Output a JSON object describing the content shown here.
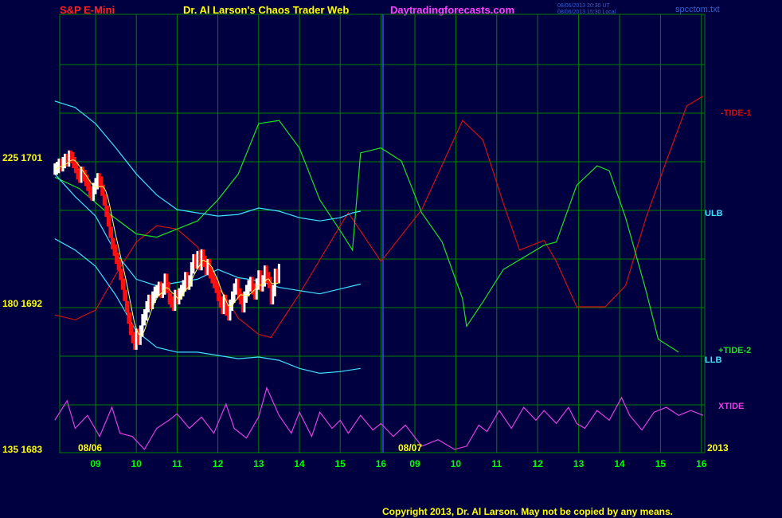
{
  "header": {
    "symbol": "S&P E-Mini",
    "title": "Dr. Al Larson's Chaos Trader Web",
    "site": "Daytradingforecasts.com",
    "timestamp_line1": "08/06/2013 20:30 UT",
    "timestamp_line2": "08/06/2013 15:30 Local",
    "filename": "spcctom.txt"
  },
  "y_labels": {
    "top": "225  1701",
    "middle": "180  1692",
    "bottom": "135  1683"
  },
  "right_labels": {
    "tide1": "-TIDE-1",
    "ulb": "ULB",
    "tide2": "+TIDE-2",
    "llb": "LLB",
    "xtide": "XTIDE"
  },
  "date_labels": {
    "day1": "08/06",
    "day2": "08/07",
    "year": "2013"
  },
  "copyright": "Copyright 2013, Dr. Al Larson. May not be copied by any means.",
  "colors": {
    "background": "#000040",
    "grid": "#008000",
    "divider": "#4040ff",
    "tide1": "#d01010",
    "tide2": "#20e020",
    "ulb": "#40e0ff",
    "llb": "#40e0ff",
    "xtide": "#e040e0",
    "price_up": "#ffffff",
    "price_down": "#ff1010",
    "ma": "#ffff60"
  },
  "chart_data": {
    "type": "line",
    "x_tick_labels": [
      "09",
      "10",
      "11",
      "12",
      "13",
      "14",
      "15",
      "16",
      "09",
      "10",
      "11",
      "12",
      "13",
      "14",
      "15",
      "16"
    ],
    "y_axis": {
      "label_top": "1701",
      "label_mid": "1692",
      "label_bottom": "1683",
      "range": [
        1683,
        1705
      ]
    },
    "series": [
      {
        "name": "-TIDE-1",
        "color": "#d01010",
        "points": [
          [
            0.0,
            1691.5
          ],
          [
            0.5,
            1691.2
          ],
          [
            1.0,
            1691.8
          ],
          [
            1.5,
            1694.0
          ],
          [
            2.0,
            1696.0
          ],
          [
            2.5,
            1697.0
          ],
          [
            3.0,
            1696.8
          ],
          [
            3.5,
            1695.7
          ],
          [
            4.0,
            1693.4
          ],
          [
            4.5,
            1691.3
          ],
          [
            5.0,
            1690.3
          ],
          [
            5.3,
            1690.1
          ],
          [
            6.0,
            1692.8
          ],
          [
            7.0,
            1697.0
          ],
          [
            7.2,
            1697.8
          ],
          [
            8.0,
            1694.8
          ],
          [
            9.0,
            1698.0
          ],
          [
            10.0,
            1703.5
          ],
          [
            10.5,
            1702.3
          ],
          [
            11.0,
            1698.4
          ],
          [
            11.4,
            1695.5
          ],
          [
            12.0,
            1696.1
          ],
          [
            12.3,
            1694.8
          ],
          [
            12.8,
            1692.0
          ],
          [
            13.5,
            1692.0
          ],
          [
            14.0,
            1693.3
          ],
          [
            14.5,
            1697.5
          ],
          [
            15.0,
            1701.0
          ],
          [
            15.5,
            1704.4
          ],
          [
            15.9,
            1705.0
          ]
        ]
      },
      {
        "name": "+TIDE-2",
        "color": "#20e020",
        "points": [
          [
            0.0,
            1700.0
          ],
          [
            0.6,
            1699.3
          ],
          [
            1.2,
            1698.0
          ],
          [
            2.0,
            1696.5
          ],
          [
            2.5,
            1696.3
          ],
          [
            3.0,
            1696.8
          ],
          [
            3.5,
            1697.3
          ],
          [
            4.0,
            1698.6
          ],
          [
            4.5,
            1700.2
          ],
          [
            5.0,
            1703.3
          ],
          [
            5.5,
            1703.5
          ],
          [
            6.0,
            1701.8
          ],
          [
            6.5,
            1698.6
          ],
          [
            7.0,
            1696.7
          ],
          [
            7.3,
            1695.5
          ],
          [
            7.5,
            1701.5
          ],
          [
            8.0,
            1701.8
          ],
          [
            8.5,
            1701.0
          ],
          [
            9.0,
            1697.8
          ],
          [
            9.5,
            1696.0
          ],
          [
            10.0,
            1692.5
          ],
          [
            10.1,
            1690.8
          ],
          [
            10.5,
            1692.3
          ],
          [
            11.0,
            1694.3
          ],
          [
            12.0,
            1695.8
          ],
          [
            12.3,
            1696.0
          ],
          [
            12.8,
            1699.5
          ],
          [
            13.3,
            1700.7
          ],
          [
            13.6,
            1700.4
          ],
          [
            14.0,
            1697.5
          ],
          [
            14.5,
            1693.0
          ],
          [
            14.8,
            1690.0
          ],
          [
            15.3,
            1689.2
          ]
        ]
      },
      {
        "name": "ULB",
        "color": "#40e0ff",
        "points": [
          [
            0.0,
            1704.7
          ],
          [
            0.5,
            1704.3
          ],
          [
            1.0,
            1703.3
          ],
          [
            1.5,
            1701.8
          ],
          [
            2.0,
            1700.2
          ],
          [
            2.5,
            1698.9
          ],
          [
            3.0,
            1698.0
          ],
          [
            3.5,
            1697.8
          ],
          [
            4.0,
            1697.6
          ],
          [
            4.5,
            1697.7
          ],
          [
            5.0,
            1698.1
          ],
          [
            5.5,
            1697.9
          ],
          [
            6.0,
            1697.5
          ],
          [
            6.5,
            1697.3
          ],
          [
            7.0,
            1697.5
          ],
          [
            7.3,
            1697.8
          ],
          [
            7.5,
            1697.9
          ]
        ]
      },
      {
        "name": "LLB",
        "color": "#40e0ff",
        "points": [
          [
            0.0,
            1696.2
          ],
          [
            0.5,
            1695.5
          ],
          [
            1.0,
            1694.5
          ],
          [
            1.5,
            1692.7
          ],
          [
            2.0,
            1690.5
          ],
          [
            2.5,
            1689.5
          ],
          [
            3.0,
            1689.2
          ],
          [
            3.5,
            1689.2
          ],
          [
            4.0,
            1689.0
          ],
          [
            4.5,
            1688.8
          ],
          [
            5.0,
            1688.9
          ],
          [
            5.5,
            1688.7
          ],
          [
            6.0,
            1688.2
          ],
          [
            6.5,
            1687.9
          ],
          [
            7.0,
            1688.0
          ],
          [
            7.5,
            1688.2
          ]
        ]
      },
      {
        "name": "ULB",
        "color": "#40e0ff",
        "points": [
          [
            0.0,
            1700.2
          ],
          [
            0.5,
            1698.8
          ],
          [
            1.0,
            1697.6
          ],
          [
            1.5,
            1695.3
          ],
          [
            2.0,
            1693.7
          ],
          [
            2.5,
            1693.3
          ],
          [
            3.0,
            1693.5
          ],
          [
            3.5,
            1693.7
          ],
          [
            4.0,
            1694.3
          ],
          [
            4.5,
            1693.8
          ],
          [
            5.0,
            1693.6
          ],
          [
            5.5,
            1693.2
          ],
          [
            6.0,
            1693.0
          ],
          [
            6.5,
            1692.8
          ],
          [
            7.0,
            1693.1
          ],
          [
            7.5,
            1693.4
          ]
        ]
      },
      {
        "name": "XTIDE",
        "color": "#e040e0",
        "points": [
          [
            0.0,
            1685.0
          ],
          [
            0.3,
            1686.2
          ],
          [
            0.5,
            1684.5
          ],
          [
            0.8,
            1685.3
          ],
          [
            1.1,
            1684.0
          ],
          [
            1.4,
            1685.8
          ],
          [
            1.6,
            1684.2
          ],
          [
            1.9,
            1684.0
          ],
          [
            2.2,
            1683.2
          ],
          [
            2.5,
            1684.5
          ],
          [
            2.8,
            1685.0
          ],
          [
            3.0,
            1685.4
          ],
          [
            3.3,
            1684.5
          ],
          [
            3.6,
            1685.2
          ],
          [
            3.9,
            1684.2
          ],
          [
            4.2,
            1686.0
          ],
          [
            4.4,
            1684.5
          ],
          [
            4.7,
            1683.9
          ],
          [
            5.0,
            1685.2
          ],
          [
            5.2,
            1687.0
          ],
          [
            5.5,
            1685.3
          ],
          [
            5.8,
            1684.2
          ],
          [
            6.0,
            1685.5
          ],
          [
            6.3,
            1684.0
          ],
          [
            6.5,
            1685.5
          ],
          [
            6.8,
            1684.5
          ],
          [
            7.0,
            1685.0
          ],
          [
            7.2,
            1684.2
          ],
          [
            7.5,
            1685.3
          ],
          [
            7.8,
            1684.4
          ],
          [
            8.0,
            1684.8
          ],
          [
            8.3,
            1684.0
          ],
          [
            8.6,
            1684.7
          ],
          [
            9.0,
            1683.4
          ],
          [
            9.4,
            1683.8
          ],
          [
            9.8,
            1683.2
          ],
          [
            10.1,
            1683.4
          ],
          [
            10.4,
            1684.7
          ],
          [
            10.6,
            1684.3
          ],
          [
            10.9,
            1685.6
          ],
          [
            11.2,
            1684.5
          ],
          [
            11.5,
            1685.8
          ],
          [
            11.8,
            1685.0
          ],
          [
            12.0,
            1685.6
          ],
          [
            12.3,
            1684.8
          ],
          [
            12.6,
            1685.8
          ],
          [
            12.8,
            1684.8
          ],
          [
            13.0,
            1684.5
          ],
          [
            13.3,
            1685.6
          ],
          [
            13.6,
            1685.0
          ],
          [
            13.9,
            1686.4
          ],
          [
            14.1,
            1685.3
          ],
          [
            14.4,
            1684.4
          ],
          [
            14.7,
            1685.5
          ],
          [
            15.0,
            1685.8
          ],
          [
            15.3,
            1685.3
          ],
          [
            15.6,
            1685.6
          ],
          [
            15.9,
            1685.3
          ]
        ]
      }
    ],
    "price": {
      "name": "S&P E-Mini",
      "x_start": 0.0,
      "x_step": 0.05,
      "close": [
        1700.5,
        1700.6,
        1700.8,
        1700.7,
        1700.9,
        1701.1,
        1701.0,
        1701.3,
        1701.2,
        1700.9,
        1700.6,
        1700.2,
        1700.0,
        1700.3,
        1700.1,
        1699.8,
        1699.5,
        1699.1,
        1698.9,
        1699.3,
        1699.6,
        1699.9,
        1699.7,
        1699.2,
        1698.6,
        1697.9,
        1697.3,
        1696.6,
        1695.9,
        1695.5,
        1695.0,
        1694.6,
        1694.0,
        1693.4,
        1692.7,
        1692.0,
        1691.3,
        1690.6,
        1690.1,
        1689.7,
        1690.3,
        1690.0,
        1690.5,
        1691.2,
        1691.5,
        1692.0,
        1692.4,
        1692.2,
        1692.6,
        1692.9,
        1693.0,
        1693.2,
        1692.9,
        1693.1,
        1693.7,
        1693.2,
        1692.5,
        1692.3,
        1692.1,
        1692.7,
        1692.5,
        1692.8,
        1693.0,
        1693.3,
        1693.8,
        1693.4,
        1693.6,
        1694.4,
        1694.9,
        1694.7,
        1695.1,
        1694.6,
        1695.2,
        1694.8,
        1694.3,
        1694.6,
        1694.1,
        1693.8,
        1693.5,
        1693.2,
        1692.7,
        1692.3,
        1691.9,
        1692.4,
        1691.8,
        1691.5,
        1692.1,
        1692.6,
        1693.1,
        1693.4,
        1692.8,
        1692.5,
        1692.0,
        1692.6,
        1693.0,
        1693.3,
        1693.5,
        1693.1,
        1692.8,
        1693.4,
        1693.9,
        1693.3,
        1693.6,
        1694.2,
        1693.8,
        1693.5,
        1692.5,
        1693.0,
        1694.0,
        1693.8,
        1694.3
      ]
    }
  }
}
